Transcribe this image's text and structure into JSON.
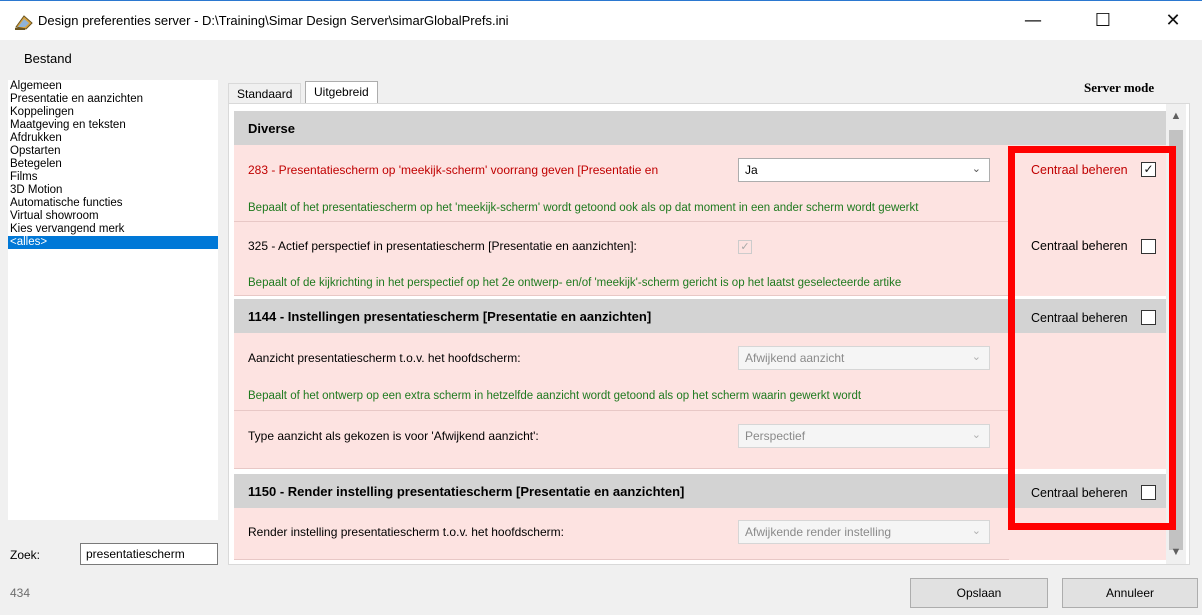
{
  "window": {
    "title": "Design preferenties server - D:\\Training\\Simar Design Server\\simarGlobalPrefs.ini",
    "minimize": "—",
    "maximize": "☐",
    "close": "✕"
  },
  "menu": {
    "file": "Bestand"
  },
  "sidebar": {
    "items": [
      "Algemeen",
      "Presentatie en aanzichten",
      "Koppelingen",
      "Maatgeving en teksten",
      "Afdrukken",
      "Opstarten",
      "Betegelen",
      "Films",
      "3D Motion",
      "Automatische functies",
      "Virtual showroom",
      "Kies vervangend merk",
      "<alles>"
    ],
    "selected": "<alles>"
  },
  "search": {
    "label": "Zoek:",
    "value": "presentatiescherm"
  },
  "count": "434",
  "tabs": {
    "standaard": "Standaard",
    "uitgebreid": "Uitgebreid",
    "active": "Uitgebreid"
  },
  "server_mode": "Server mode",
  "sections": {
    "diverse": {
      "title": "Diverse"
    },
    "s1144": {
      "title": "1144 - Instellingen presentatiescherm [Presentatie en aanzichten]",
      "central_label": "Centraal beheren",
      "central_checked": false
    },
    "s1150": {
      "title": "1150 - Render instelling presentatiescherm [Presentatie en aanzichten]",
      "central_label": "Centraal beheren",
      "central_checked": false
    }
  },
  "rows": {
    "r283": {
      "label": "283 - Presentatiescherm op 'meekijk-scherm' voorrang geven [Presentatie en",
      "value": "Ja",
      "description": "Bepaalt of het presentatiescherm op het 'meekijk-scherm' wordt getoond ook als op dat moment in een ander scherm wordt gewerkt",
      "central_label": "Centraal beheren",
      "central_checked": true,
      "central_mark": "✓"
    },
    "r325": {
      "label": "325 - Actief perspectief in presentatiescherm [Presentatie en aanzichten]:",
      "checkbox_mark": "✓",
      "description": "Bepaalt of de kijkrichting in het perspectief op het 2e ontwerp- en/of 'meekijk'-scherm gericht is op het laatst geselecteerde artike",
      "central_label": "Centraal beheren",
      "central_checked": false
    },
    "aanzicht": {
      "label": "Aanzicht presentatiescherm t.o.v. het hoofdscherm:",
      "value": "Afwijkend aanzicht",
      "description": "Bepaalt of het ontwerp op een extra scherm in hetzelfde aanzicht wordt getoond als op het scherm waarin gewerkt wordt"
    },
    "type": {
      "label": "Type aanzicht als gekozen is voor 'Afwijkend aanzicht':",
      "value": "Perspectief"
    },
    "render": {
      "label": "Render instelling presentatiescherm t.o.v. het hoofdscherm:",
      "value": "Afwijkende render instelling"
    }
  },
  "buttons": {
    "save": "Opslaan",
    "cancel": "Annuleer"
  },
  "icons": {
    "dropdown": "chevron-down-icon",
    "scroll_up": "▲",
    "scroll_down": "▼"
  },
  "colors": {
    "accent": "#0078d7",
    "highlight": "#ff0000",
    "row_bg": "#fde3e1",
    "header_bg": "#d3d3d3",
    "desc_text": "#1f7a1f",
    "warn_text": "#c00000"
  }
}
